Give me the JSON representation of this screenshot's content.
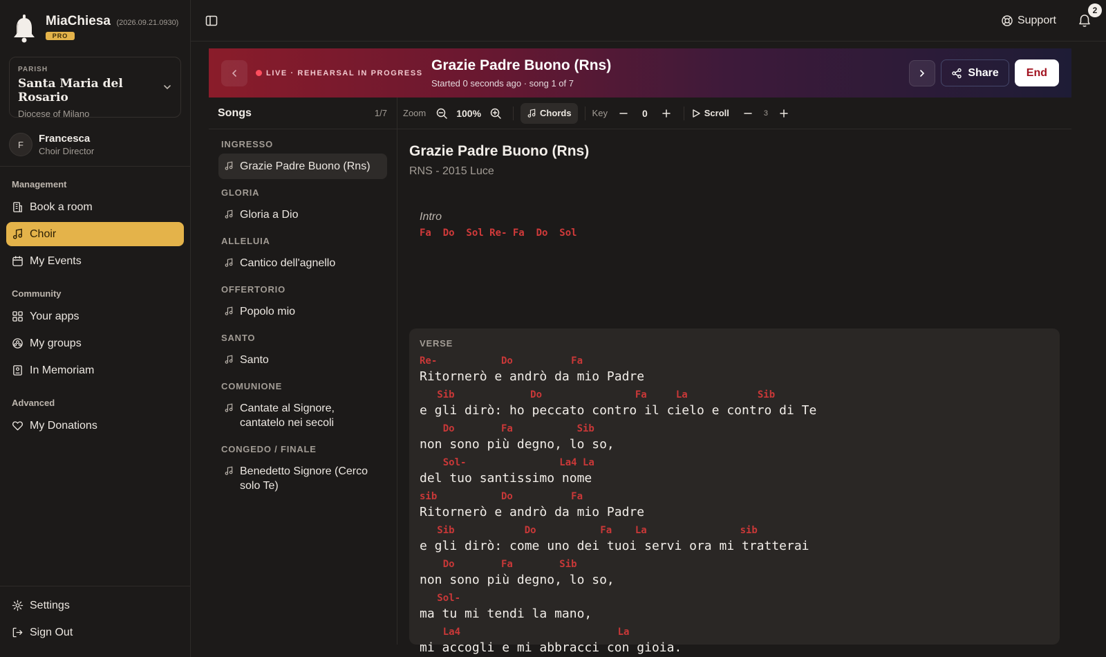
{
  "brand": {
    "name": "MiaChiesa",
    "version": "(2026.09.21.0930)",
    "badge": "PRO"
  },
  "parish": {
    "label": "PARISH",
    "name": "Santa Maria del Rosario",
    "diocese": "Diocese of Milano"
  },
  "user": {
    "initial": "F",
    "name": "Francesca",
    "role": "Choir Director"
  },
  "nav": {
    "management_heading": "Management",
    "management": [
      {
        "label": "Book a room",
        "icon": "building-icon"
      },
      {
        "label": "Choir",
        "icon": "music-note-icon",
        "active": true
      },
      {
        "label": "My Events",
        "icon": "calendar-icon"
      }
    ],
    "community_heading": "Community",
    "community": [
      {
        "label": "Your apps",
        "icon": "grid-icon"
      },
      {
        "label": "My groups",
        "icon": "groups-icon"
      },
      {
        "label": "In Memoriam",
        "icon": "memorial-icon"
      }
    ],
    "advanced_heading": "Advanced",
    "advanced": [
      {
        "label": "My Donations",
        "icon": "heart-icon"
      }
    ],
    "bottom": [
      {
        "label": "Settings",
        "icon": "gear-icon"
      },
      {
        "label": "Sign Out",
        "icon": "sign-out-icon"
      }
    ]
  },
  "topbar": {
    "support_label": "Support",
    "notification_count": "2"
  },
  "live": {
    "status": "LIVE · REHEARSAL IN PROGRESS",
    "title": "Grazie Padre Buono (Rns)",
    "subtitle": "Started 0 seconds ago · song 1 of 7",
    "share_label": "Share",
    "end_label": "End",
    "accent_color": "#8a1c2a"
  },
  "songs": {
    "title": "Songs",
    "count": "1/7",
    "groups": [
      {
        "name": "INGRESSO",
        "songs": [
          "Grazie Padre Buono (Rns)"
        ]
      },
      {
        "name": "GLORIA",
        "songs": [
          "Gloria a Dio"
        ]
      },
      {
        "name": "ALLELUIA",
        "songs": [
          "Cantico dell'agnello"
        ]
      },
      {
        "name": "OFFERTORIO",
        "songs": [
          "Popolo mio"
        ]
      },
      {
        "name": "SANTO",
        "songs": [
          "Santo"
        ]
      },
      {
        "name": "COMUNIONE",
        "songs": [
          "Cantate al Signore, cantatelo nei secoli"
        ]
      },
      {
        "name": "CONGEDO / FINALE",
        "songs": [
          "Benedetto Signore (Cerco solo Te)"
        ]
      }
    ]
  },
  "toolbar": {
    "zoom_label": "Zoom",
    "zoom_value": "100%",
    "chords_label": "Chords",
    "key_label": "Key",
    "key_value": "0",
    "scroll_label": "Scroll",
    "scroll_value": "3"
  },
  "sheet": {
    "title": "Grazie Padre Buono (Rns)",
    "subtitle": "RNS - 2015 Luce",
    "intro_label": "Intro",
    "intro_chords": "Fa  Do  Sol Re- Fa  Do  Sol",
    "verse_label": "VERSE",
    "lines": [
      {
        "chords": "Re-           Do          Fa",
        "lyric": "Ritornerò e andrò da mio Padre"
      },
      {
        "chords": "   Sib             Do                Fa     La            Sib",
        "lyric": "e gli dirò: ho peccato contro il cielo e contro di Te"
      },
      {
        "chords": "    Do        Fa           Sib",
        "lyric": "non sono più degno, lo so,"
      },
      {
        "chords": "    Sol-                La4 La",
        "lyric": "del tuo santissimo nome"
      },
      {
        "chords": "sib           Do          Fa",
        "lyric": "Ritornerò e andrò da mio Padre"
      },
      {
        "chords": "   Sib            Do           Fa    La                sib",
        "lyric": "e gli dirò: come uno dei tuoi servi ora mi tratterai"
      },
      {
        "chords": "    Do        Fa        Sib",
        "lyric": "non sono più degno, lo so,"
      },
      {
        "chords": "   Sol-",
        "lyric": "ma tu mi tendi la mano,"
      },
      {
        "chords": "    La4                           La",
        "lyric": "mi accogli e mi abbracci con gioia."
      }
    ]
  }
}
